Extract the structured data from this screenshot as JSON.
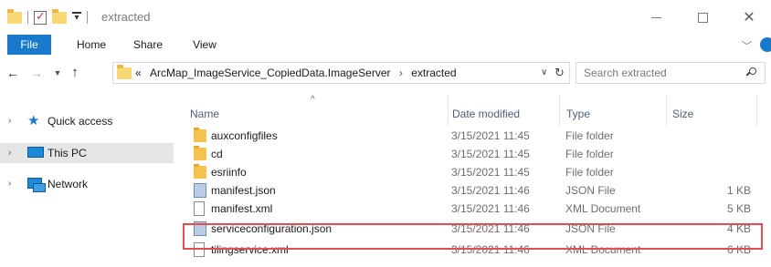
{
  "window": {
    "title": "extracted"
  },
  "ribbon": {
    "tabs": [
      {
        "label": "File"
      },
      {
        "label": "Home"
      },
      {
        "label": "Share"
      },
      {
        "label": "View"
      }
    ]
  },
  "address_bar": {
    "overflow": "«",
    "segments": [
      "ArcMap_ImageService_CopiedData.ImageServer",
      "extracted"
    ],
    "separator": "›"
  },
  "search": {
    "placeholder": "Search extracted"
  },
  "nav_pane": {
    "items": [
      {
        "label": "Quick access",
        "icon": "star-icon"
      },
      {
        "label": "This PC",
        "icon": "computer-icon",
        "selected": true
      },
      {
        "label": "Network",
        "icon": "network-icon"
      }
    ]
  },
  "columns": {
    "name": "Name",
    "date": "Date modified",
    "type": "Type",
    "size": "Size"
  },
  "files": [
    {
      "name": "auxconfigfiles",
      "date": "3/15/2021 11:45",
      "type": "File folder",
      "size": "",
      "icon": "folder-icon"
    },
    {
      "name": "cd",
      "date": "3/15/2021 11:45",
      "type": "File folder",
      "size": "",
      "icon": "folder-icon"
    },
    {
      "name": "esriinfo",
      "date": "3/15/2021 11:45",
      "type": "File folder",
      "size": "",
      "icon": "folder-icon"
    },
    {
      "name": "manifest.json",
      "date": "3/15/2021 11:46",
      "type": "JSON File",
      "size": "1 KB",
      "icon": "json-file-icon"
    },
    {
      "name": "manifest.xml",
      "date": "3/15/2021 11:46",
      "type": "XML Document",
      "size": "5 KB",
      "icon": "xml-file-icon"
    },
    {
      "name": "serviceconfiguration.json",
      "date": "3/15/2021 11:46",
      "type": "JSON File",
      "size": "4 KB",
      "icon": "json-file-icon",
      "highlighted": true
    },
    {
      "name": "tilingservice.xml",
      "date": "3/15/2021 11:46",
      "type": "XML Document",
      "size": "6 KB",
      "icon": "xml-file-icon"
    }
  ],
  "colors": {
    "accent": "#1979ca",
    "highlight_border": "#e04d57",
    "folder": "#f4c34e"
  }
}
